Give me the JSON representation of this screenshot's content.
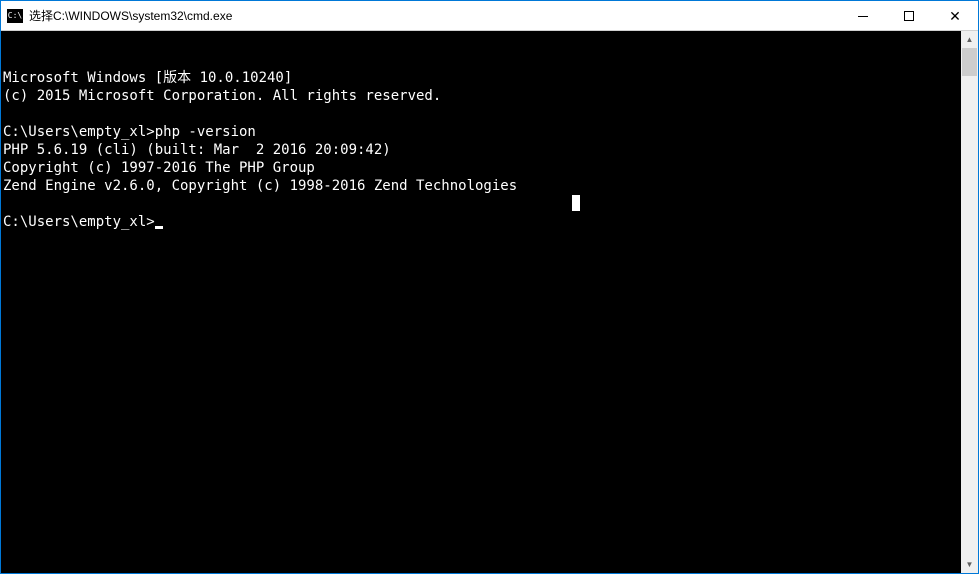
{
  "window": {
    "title": "选择C:\\WINDOWS\\system32\\cmd.exe",
    "icon_label": "C:\\"
  },
  "terminal": {
    "lines": [
      "Microsoft Windows [版本 10.0.10240]",
      "(c) 2015 Microsoft Corporation. All rights reserved.",
      "",
      "C:\\Users\\empty_xl>php -version",
      "PHP 5.6.19 (cli) (built: Mar  2 2016 20:09:42)",
      "Copyright (c) 1997-2016 The PHP Group",
      "Zend Engine v2.6.0, Copyright (c) 1998-2016 Zend Technologies",
      "",
      "C:\\Users\\empty_xl>"
    ],
    "prompt_cursor_line_index": 8
  }
}
